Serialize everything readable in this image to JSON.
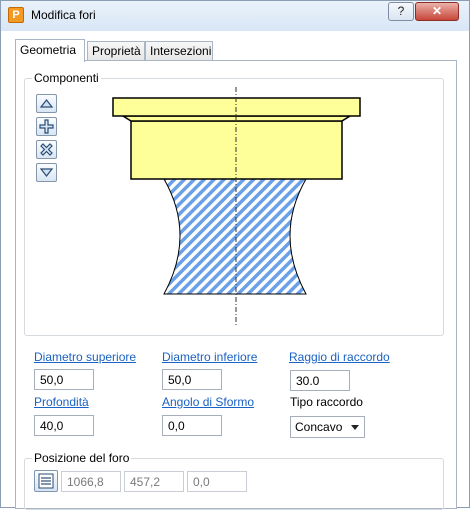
{
  "window": {
    "title": "Modifica fori",
    "help_label": "?",
    "close_label": "✕",
    "app_icon_letter": "P"
  },
  "tabs": [
    {
      "label": "Geometria",
      "active": true
    },
    {
      "label": "Proprietà",
      "active": false
    },
    {
      "label": "Intersezioni",
      "active": false
    }
  ],
  "components": {
    "group_label": "Componenti",
    "buttons": [
      "arrow-up-icon",
      "add-icon",
      "remove-icon",
      "arrow-down-icon"
    ],
    "colors": {
      "counterbore_fill": "#ffff99",
      "hatch": "#6aa0e8",
      "outline": "#000000"
    }
  },
  "fields": {
    "diametro_superiore": {
      "label": "Diametro superiore",
      "value": "50,0"
    },
    "diametro_inferiore": {
      "label": "Diametro inferiore",
      "value": "50,0"
    },
    "raggio_di_raccordo": {
      "label": "Raggio di raccordo",
      "value": "30.0"
    },
    "profondita": {
      "label": "Profondità",
      "value": "40,0"
    },
    "angolo_di_sformo": {
      "label": "Angolo di Sformo",
      "value": "0,0"
    },
    "tipo_raccordo": {
      "label": "Tipo raccordo",
      "value": "Concavo"
    }
  },
  "posizione": {
    "group_label": "Posizione del foro",
    "x": "1066,8",
    "y": "457,2",
    "z": "0,0"
  }
}
